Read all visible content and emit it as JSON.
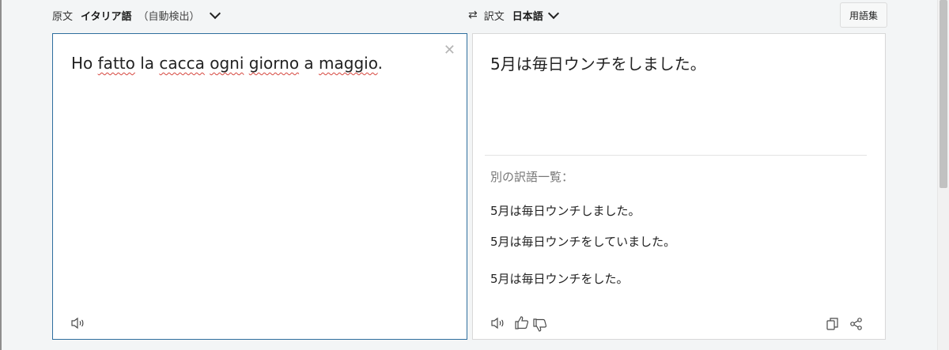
{
  "source_bar": {
    "label": "原文",
    "language": "イタリア語",
    "detect": "（自動検出）"
  },
  "target_bar": {
    "label": "訳文",
    "language": "日本語"
  },
  "glossary_label": "用語集",
  "source": {
    "words": [
      "Ho",
      "fatto",
      "la",
      "cacca",
      "ogni",
      "giorno",
      "a",
      "maggio",
      "."
    ]
  },
  "target": {
    "translation": "5月は毎日ウンチをしました。",
    "alternatives_heading": "別の訳語一覧：",
    "alternatives": [
      "5月は毎日ウンチしました。",
      "5月は毎日ウンチをしていました。",
      "5月は毎日ウンチをした。"
    ]
  },
  "icons": {
    "clear": "close-icon",
    "speaker_source": "speaker-icon",
    "speaker_target": "speaker-icon",
    "thumbs_up": "thumbs-up-icon",
    "thumbs_down": "thumbs-down-icon",
    "copy": "copy-icon",
    "share": "share-icon",
    "swap": "swap-icon"
  },
  "colors": {
    "active_border": "#2e6e9e",
    "spellcheck_underline": "#d6453d"
  }
}
